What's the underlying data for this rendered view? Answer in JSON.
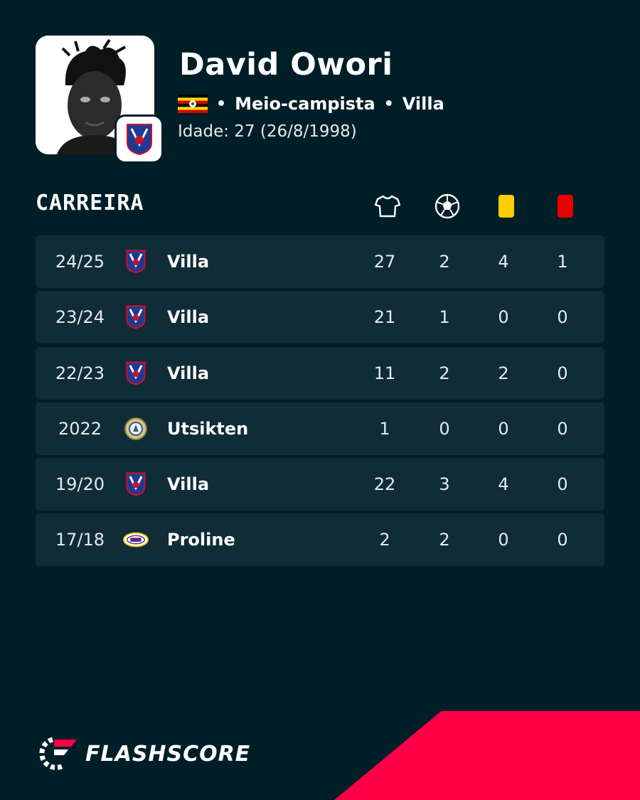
{
  "player": {
    "name": "David Owori",
    "position": "Meio-campista",
    "club": "Villa",
    "age_label": "Idade: 27  (26/8/1998)",
    "separator": "•"
  },
  "career": {
    "title": "CARREIRA",
    "columns": [
      {
        "icon": "shirt-icon"
      },
      {
        "icon": "ball-icon"
      },
      {
        "icon": "yellow-card-icon",
        "color": "#ffcd00"
      },
      {
        "icon": "red-card-icon",
        "color": "#e60000"
      }
    ],
    "rows": [
      {
        "season": "24/25",
        "team": "Villa",
        "logo": "villa-logo",
        "apps": "27",
        "goals": "2",
        "yellow": "4",
        "red": "1"
      },
      {
        "season": "23/24",
        "team": "Villa",
        "logo": "villa-logo",
        "apps": "21",
        "goals": "1",
        "yellow": "0",
        "red": "0"
      },
      {
        "season": "22/23",
        "team": "Villa",
        "logo": "villa-logo",
        "apps": "11",
        "goals": "2",
        "yellow": "2",
        "red": "0"
      },
      {
        "season": "2022",
        "team": "Utsikten",
        "logo": "utsikten-logo",
        "apps": "1",
        "goals": "0",
        "yellow": "0",
        "red": "0"
      },
      {
        "season": "19/20",
        "team": "Villa",
        "logo": "villa-logo",
        "apps": "22",
        "goals": "3",
        "yellow": "4",
        "red": "0"
      },
      {
        "season": "17/18",
        "team": "Proline",
        "logo": "proline-logo",
        "apps": "2",
        "goals": "2",
        "yellow": "0",
        "red": "0"
      }
    ]
  },
  "brand": {
    "name": "FLASHSCORE",
    "accent": "#ff0046",
    "background": "#001e28"
  }
}
